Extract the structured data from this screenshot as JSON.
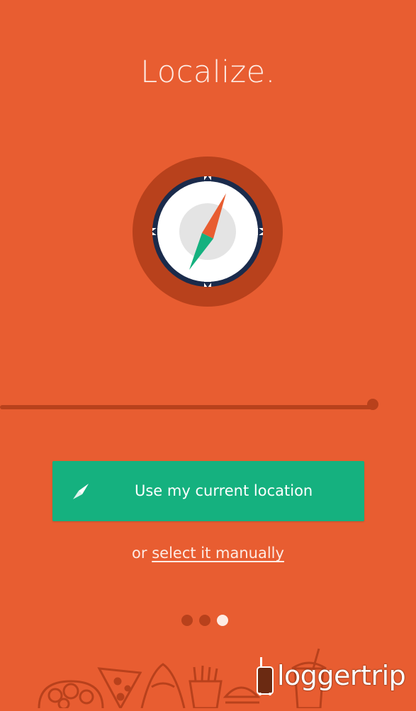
{
  "screen": {
    "title": "Localize.",
    "background_color": "#E85D31"
  },
  "illustration": {
    "icon": "compass-icon",
    "ring_color": "#B8411C",
    "needle_colors": [
      "#E85D31",
      "#15B17F"
    ]
  },
  "cta": {
    "label": "Use my current location",
    "icon": "compass-needle-icon",
    "color": "#15B17F"
  },
  "manual": {
    "prefix": "or",
    "link_label": "select it manually"
  },
  "pager": {
    "count": 3,
    "active_index": 2
  },
  "decoration": {
    "icons": [
      "noodle-bowl-icon",
      "pizza-slice-icon",
      "croissant-icon",
      "fries-icon",
      "burger-icon",
      "drink-cup-icon"
    ]
  },
  "watermark": {
    "text": "loggertrip",
    "icon": "suitcase-icon"
  }
}
